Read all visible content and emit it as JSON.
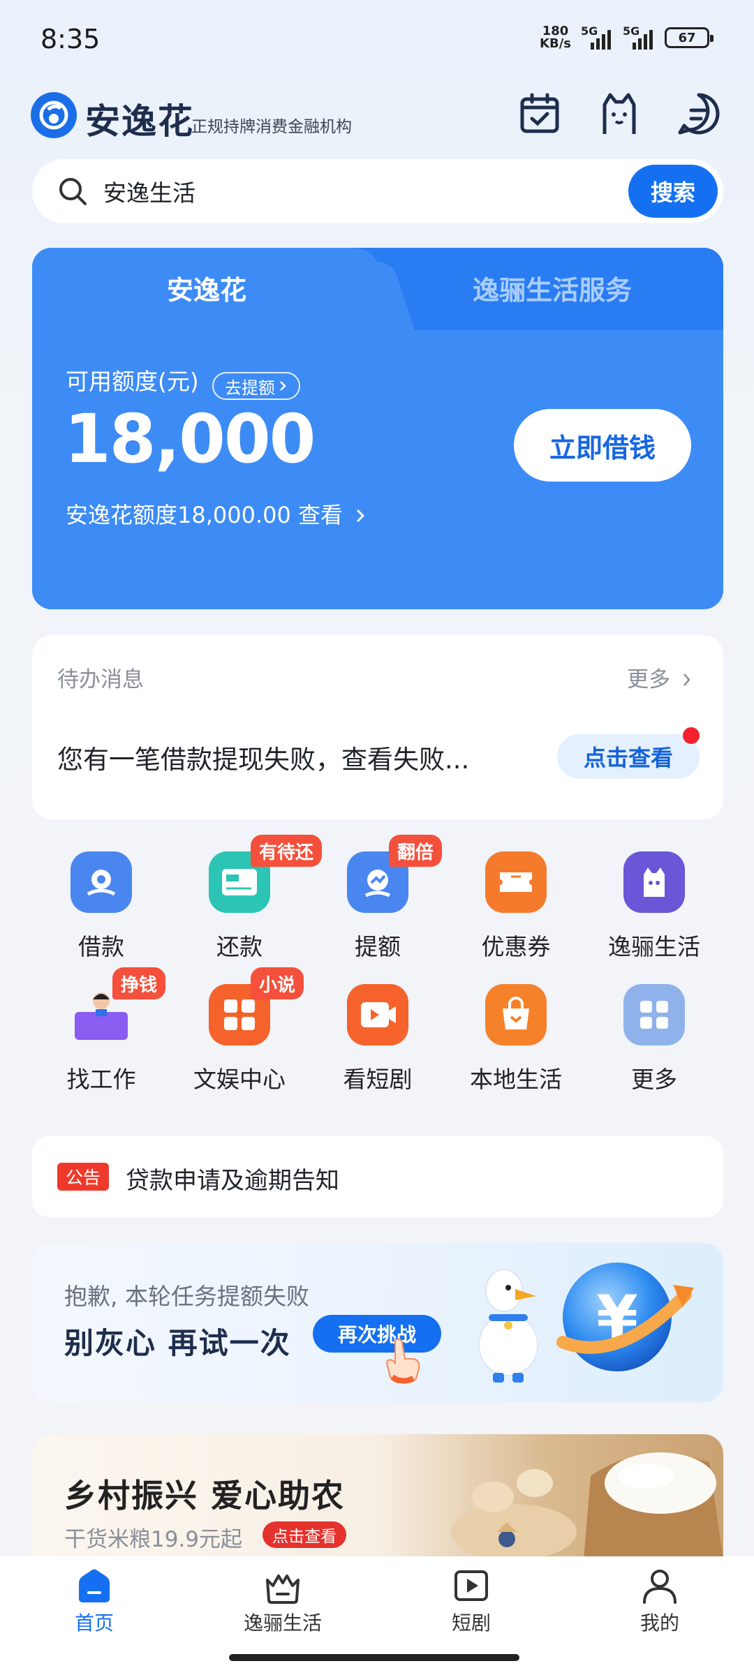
{
  "status_bar": {
    "time": "8:35",
    "net_speed_value": "180",
    "net_speed_unit": "KB/s",
    "signal_1": "5G",
    "signal_2": "5G",
    "battery": "67"
  },
  "header": {
    "app_name": "安逸花",
    "slogan": "正规持牌消费金融机构"
  },
  "search": {
    "text": "安逸生活",
    "button": "搜索"
  },
  "credit_card": {
    "tabs": [
      "安逸花",
      "逸骊生活服务"
    ],
    "available_label": "可用额度(元)",
    "raise_label": "去提额",
    "amount": "18,000",
    "borrow_button": "立即借钱",
    "limit_text": "安逸花额度18,000.00 查看"
  },
  "pending": {
    "title": "待办消息",
    "more": "更多",
    "message": "您有一笔借款提现失败，查看失败...",
    "view_button": "点击查看"
  },
  "grid": [
    {
      "label": "借款",
      "icon": "loan-icon",
      "color": "#4a86f0",
      "badge": ""
    },
    {
      "label": "还款",
      "icon": "repay-icon",
      "color": "#2cc4b4",
      "badge": "有待还"
    },
    {
      "label": "提额",
      "icon": "raise-icon",
      "color": "#4a86f0",
      "badge": "翻倍"
    },
    {
      "label": "优惠券",
      "icon": "coupon-icon",
      "color": "#f57a2b",
      "badge": ""
    },
    {
      "label": "逸骊生活",
      "icon": "life-icon",
      "color": "#6a56d6",
      "badge": ""
    },
    {
      "label": "找工作",
      "icon": "job-icon",
      "color": "#8a5cf0",
      "badge": "挣钱"
    },
    {
      "label": "文娱中心",
      "icon": "entertainment-icon",
      "color": "#f5622b",
      "badge": "小说"
    },
    {
      "label": "看短剧",
      "icon": "short-drama-icon",
      "color": "#f5622b",
      "badge": ""
    },
    {
      "label": "本地生活",
      "icon": "local-life-icon",
      "color": "#f5822b",
      "badge": ""
    },
    {
      "label": "更多",
      "icon": "more-grid-icon",
      "color": "#8fb2ea",
      "badge": ""
    }
  ],
  "notice": {
    "tag": "公告",
    "text": "贷款申请及逾期告知"
  },
  "challenge": {
    "subtitle": "抱歉, 本轮任务提额失败",
    "title": "别灰心 再试一次",
    "button": "再次挑战"
  },
  "farm": {
    "title": "乡村振兴 爱心助农",
    "subtitle": "干货米粮19.9元起",
    "tag": "点击查看"
  },
  "bottom_nav": [
    {
      "label": "首页",
      "icon": "home-icon",
      "active": true
    },
    {
      "label": "逸骊生活",
      "icon": "basket-icon",
      "active": false
    },
    {
      "label": "短剧",
      "icon": "play-icon",
      "active": false
    },
    {
      "label": "我的",
      "icon": "profile-icon",
      "active": false
    }
  ],
  "colors": {
    "primary": "#1470f0",
    "card_blue": "#3d8bf5",
    "badge_red": "#f4503c"
  }
}
